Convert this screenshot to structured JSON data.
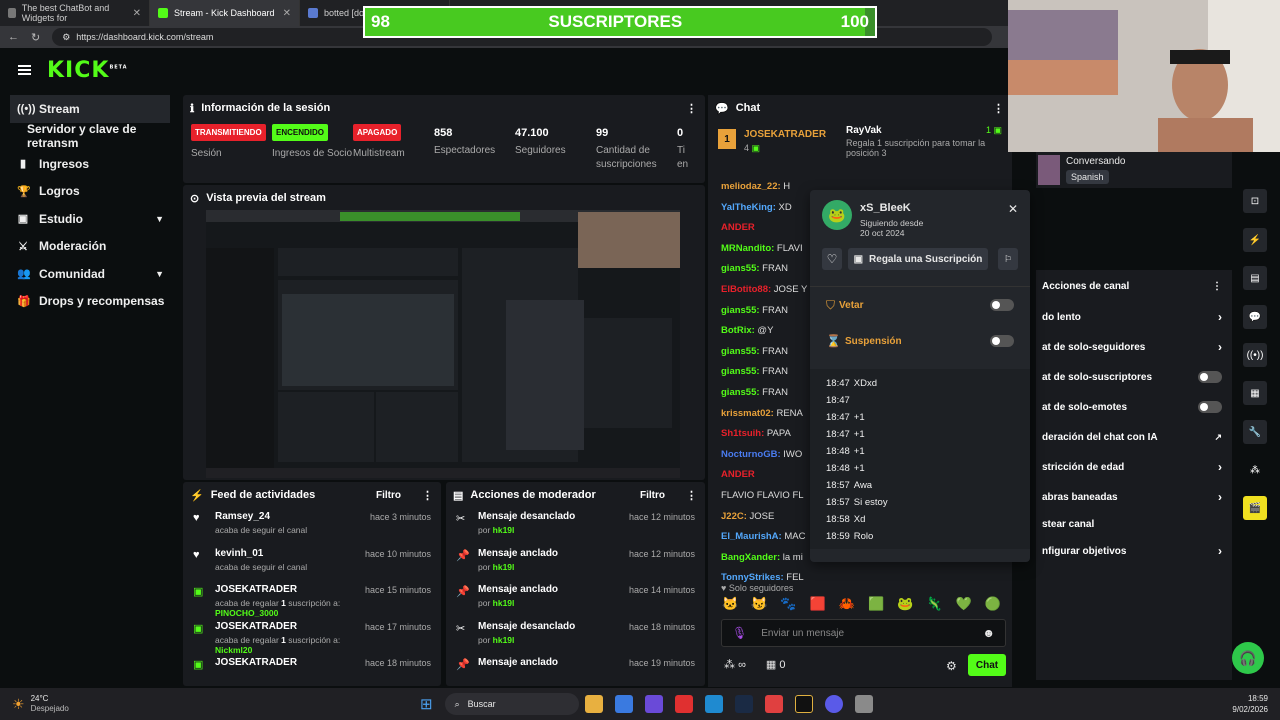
{
  "browser": {
    "tabs": [
      {
        "label": "The best ChatBot and Widgets for"
      },
      {
        "label": "Stream - Kick Dashboard"
      },
      {
        "label": "botted [dot"
      }
    ],
    "url": "https://dashboard.kick.com/stream"
  },
  "overlay": {
    "current": "98",
    "label": "SUSCRIPTORES",
    "goal": "100",
    "progress": 0.98
  },
  "brand": {
    "logo": "KICK",
    "badge": "BETA"
  },
  "sidebar": {
    "items": [
      {
        "label": "Stream",
        "icon": "radio-icon"
      },
      {
        "label": "Servidor y clave de retransm"
      },
      {
        "label": "Ingresos",
        "icon": "chart-icon"
      },
      {
        "label": "Logros",
        "icon": "trophy-icon"
      },
      {
        "label": "Estudio",
        "icon": "studio-icon"
      },
      {
        "label": "Moderación",
        "icon": "sword-icon"
      },
      {
        "label": "Comunidad",
        "icon": "people-icon"
      },
      {
        "label": "Drops y recompensas",
        "icon": "gift-icon"
      }
    ]
  },
  "session": {
    "title": "Información de la sesión",
    "stats": [
      {
        "badge": "TRANSMITIENDO",
        "label": "Sesión",
        "color": "#e8212b"
      },
      {
        "badge": "ENCENDIDO",
        "label": "Ingresos de Socio",
        "color": "#53fc18"
      },
      {
        "badge": "APAGADO",
        "label": "Multistream",
        "color": "#e8212b"
      },
      {
        "value": "858",
        "label": "Espectadores"
      },
      {
        "value": "47.100",
        "label": "Seguidores"
      },
      {
        "value": "99",
        "label": "Cantidad de suscripciones"
      },
      {
        "value": "0",
        "label": "Ti en"
      }
    ]
  },
  "preview": {
    "title": "Vista previa del stream"
  },
  "feed": {
    "title": "Feed de actividades",
    "filter": "Filtro",
    "items": [
      {
        "name": "Ramsey_24",
        "desc": "acaba de seguir el canal",
        "time": "hace 3 minutos",
        "icon": "heart-icon"
      },
      {
        "name": "kevinh_01",
        "desc": "acaba de seguir el canal",
        "time": "hace 10 minutos",
        "icon": "heart-icon"
      },
      {
        "name": "JOSEKATRADER",
        "desc": "acaba de regalar ",
        "count": "1",
        "desc2": " suscripción a: ",
        "target": "PINOCHO_3000",
        "time": "hace 15 minutos",
        "icon": "gift-icon"
      },
      {
        "name": "JOSEKATRADER",
        "desc": "acaba de regalar ",
        "count": "1",
        "desc2": " suscripción a: ",
        "target": "Nickml20",
        "time": "hace 17 minutos",
        "icon": "gift-icon"
      },
      {
        "name": "JOSEKATRADER",
        "desc": "",
        "time": "hace 18 minutos",
        "icon": "gift-icon"
      }
    ]
  },
  "mod": {
    "title": "Acciones de moderador",
    "filter": "Filtro",
    "items": [
      {
        "name": "Mensaje desanclado",
        "by": "por ",
        "mod": "hk19l",
        "time": "hace 12 minutos",
        "icon": "unpin-icon"
      },
      {
        "name": "Mensaje anclado",
        "by": "por ",
        "mod": "hk19l",
        "time": "hace 12 minutos",
        "icon": "pin-icon"
      },
      {
        "name": "Mensaje anclado",
        "by": "por ",
        "mod": "hk19l",
        "time": "hace 14 minutos",
        "icon": "pin-icon"
      },
      {
        "name": "Mensaje desanclado",
        "by": "por ",
        "mod": "hk19l",
        "time": "hace 18 minutos",
        "icon": "unpin-icon"
      },
      {
        "name": "Mensaje anclado",
        "by": "por ",
        "mod": "hk19l",
        "time": "hace 19 minutos",
        "icon": "pin-icon"
      }
    ]
  },
  "chat": {
    "title": "Chat",
    "top_gifter": {
      "name": "JOSEKATRADER",
      "rank": "1",
      "count": "4"
    },
    "gift_user": "RayVak",
    "gift_count": "1",
    "gift_text": "Regala 1 suscripción para tomar la posición 3",
    "messages": [
      {
        "user": "meliodaz_22:",
        "text": " H",
        "color": "#e8a13a"
      },
      {
        "user": "YalTheKing:",
        "text": " XD",
        "color": "#53a8fc"
      },
      {
        "user": "ANDER",
        "text": "",
        "color": "#e8212b"
      },
      {
        "user": "MRNandito:",
        "text": " FLAVI",
        "color": "#53fc18"
      },
      {
        "user": "gians55:",
        "text": " FRAN",
        "color": "#53fc18"
      },
      {
        "user": "ElBotito88:",
        "text": " JOSE Y",
        "color": "#e8212b"
      },
      {
        "user": "gians55:",
        "text": " FRAN",
        "color": "#53fc18"
      },
      {
        "user": "BotRix:",
        "text": " @Y",
        "color": "#53fc18"
      },
      {
        "user": "gians55:",
        "text": " FRAN",
        "color": "#53fc18"
      },
      {
        "user": "gians55:",
        "text": " FRAN",
        "color": "#53fc18"
      },
      {
        "user": "gians55:",
        "text": " FRAN",
        "color": "#53fc18"
      },
      {
        "user": "krissmat02:",
        "text": " RENA",
        "color": "#e8a13a"
      },
      {
        "user": "Sh1tsuih:",
        "text": " PAPA",
        "color": "#e8212b"
      },
      {
        "user": "NocturnoGB:",
        "text": " IWO",
        "color": "#4a7cf0"
      },
      {
        "user": "ANDER",
        "text": "",
        "color": "#e8212b"
      },
      {
        "user": "",
        "text": "FLAVIO FLAVIO FL",
        "color": "#ddd"
      },
      {
        "user": "J22C:",
        "text": " JOSE",
        "color": "#e8a13a"
      },
      {
        "user": "El_MaurishA:",
        "text": " MAC",
        "color": "#53a8fc"
      },
      {
        "user": "BangXander:",
        "text": " la mi",
        "color": "#53fc18"
      },
      {
        "user": "TonnyStrikes:",
        "text": " FEL",
        "color": "#53a8fc"
      }
    ],
    "followers_only": "Solo seguidores",
    "placeholder": "Enviar un mensaje",
    "send": "Chat",
    "points": "∞",
    "store_count": "0"
  },
  "profile": {
    "name": "xS_BleeK",
    "following_label": "Siguiendo desde",
    "following_date": "20 oct 2024",
    "gift_button": "Regala una Suscripción",
    "ban": "Vetar",
    "timeout": "Suspensión",
    "log": [
      {
        "time": "18:47",
        "text": "XDxd"
      },
      {
        "time": "18:47",
        "text": ""
      },
      {
        "time": "18:47",
        "text": "+1"
      },
      {
        "time": "18:47",
        "text": "+1"
      },
      {
        "time": "18:48",
        "text": "+1"
      },
      {
        "time": "18:48",
        "text": "+1"
      },
      {
        "time": "18:57",
        "text": "Awa"
      },
      {
        "time": "18:57",
        "text": "Si estoy"
      },
      {
        "time": "18:58",
        "text": "Xd"
      },
      {
        "time": "18:59",
        "text": "Rolo"
      }
    ]
  },
  "webcam_overlay": {
    "status": "Conversando",
    "language": "Spanish"
  },
  "channel_actions": {
    "title": "Acciones de canal",
    "items": [
      {
        "label": "do lento",
        "type": "chevron"
      },
      {
        "label": "at de solo-seguidores",
        "type": "chevron"
      },
      {
        "label": "at de solo-suscriptores",
        "type": "toggle"
      },
      {
        "label": "at de solo-emotes",
        "type": "toggle"
      },
      {
        "label": "deración del chat con IA",
        "type": "external"
      },
      {
        "label": "stricción de edad",
        "type": "chevron"
      },
      {
        "label": "abras baneadas",
        "type": "chevron"
      },
      {
        "label": "stear canal",
        "type": "none"
      },
      {
        "label": "nfigurar objetivos",
        "type": "chevron"
      }
    ]
  },
  "taskbar": {
    "weather_temp": "24°C",
    "weather_text": "Despejado",
    "search": "Buscar",
    "time": "18:59",
    "date": "9/02/2026"
  }
}
